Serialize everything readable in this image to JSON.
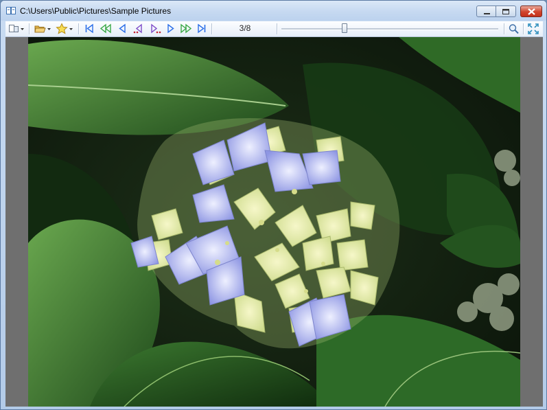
{
  "window": {
    "title": "C:\\Users\\Public\\Pictures\\Sample Pictures"
  },
  "caption_buttons": [
    "minimize",
    "maximize",
    "close"
  ],
  "toolbar": {
    "icons": [
      "view-menu-icon",
      "open-folder-icon",
      "favorites-star-icon",
      "first-icon",
      "previous-fast-icon",
      "previous-icon",
      "previous-folder-icon",
      "next-folder-icon",
      "next-icon",
      "next-fast-icon",
      "last-icon",
      "zoom-icon",
      "fullscreen-icon"
    ],
    "counter": "3/8",
    "slider_position": 0.29,
    "nav_color": "#2a6ee8"
  },
  "viewer": {
    "background": "#6f6f6f"
  }
}
